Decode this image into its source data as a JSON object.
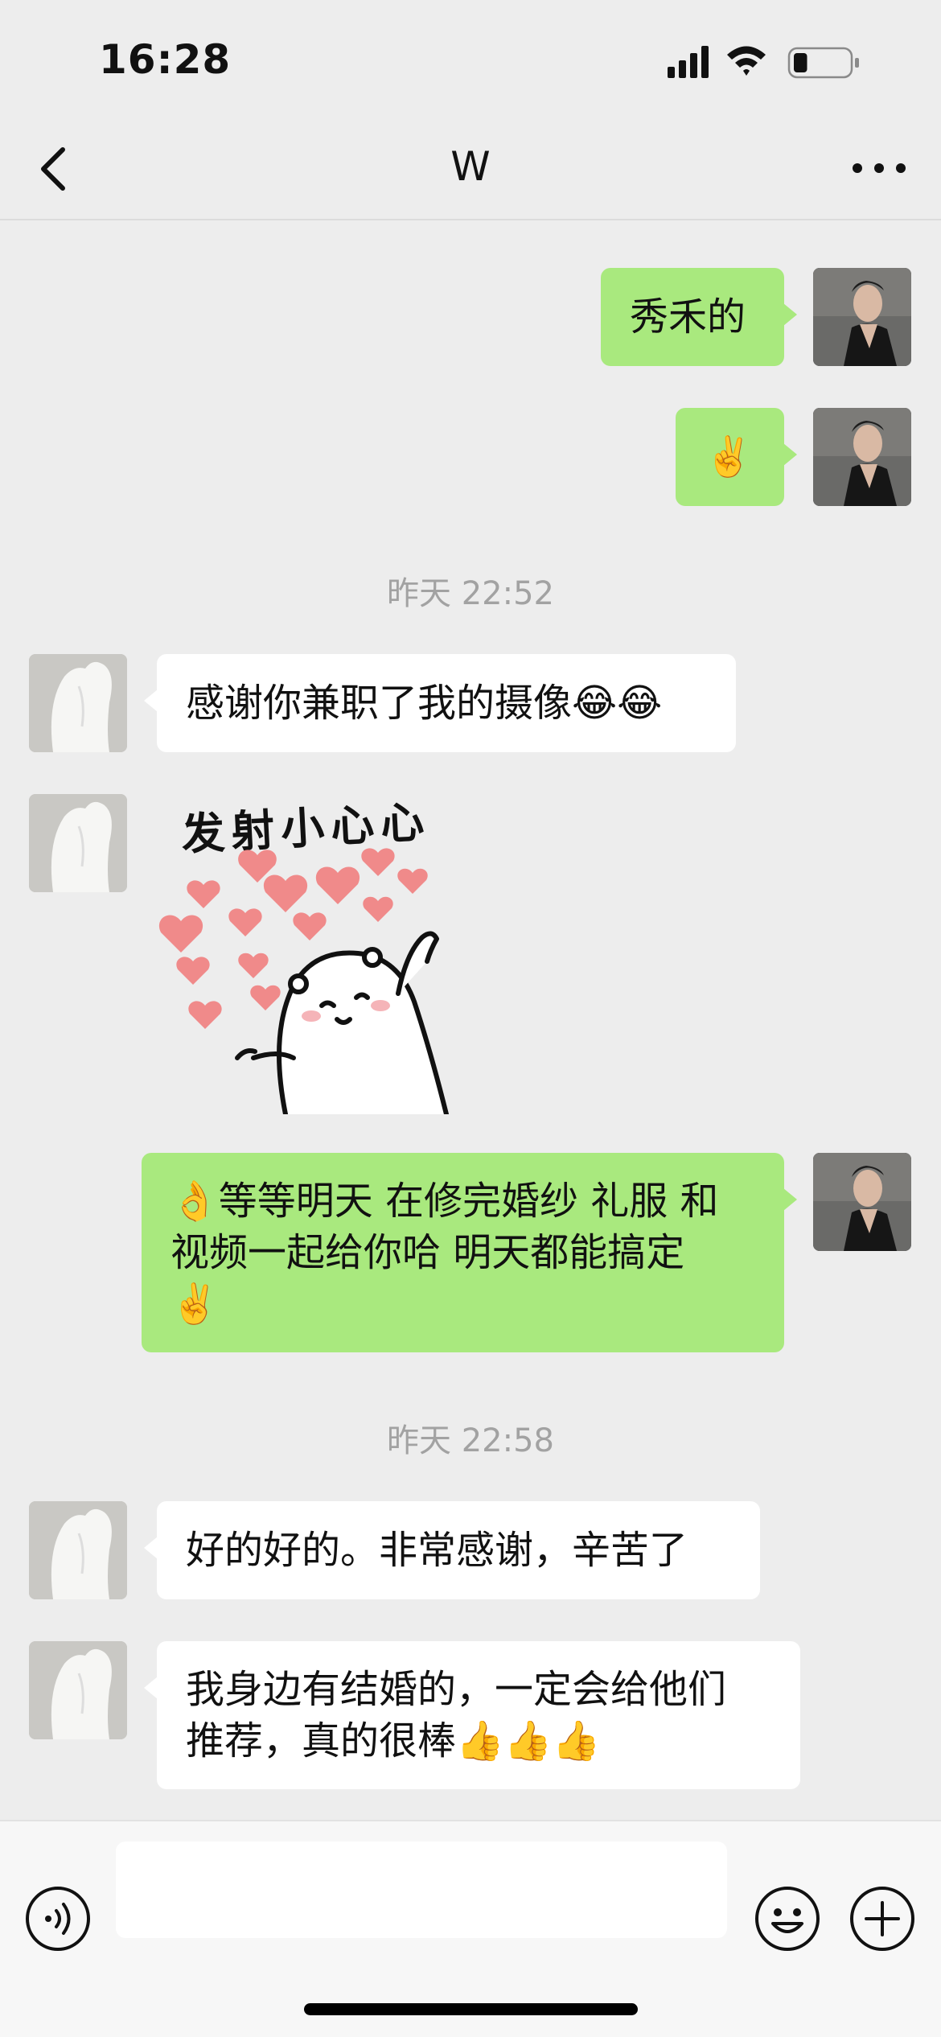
{
  "status_bar": {
    "time": "16:28",
    "icons": [
      "cellular-signal-icon",
      "wifi-icon",
      "battery-icon"
    ],
    "battery_level": 0.25
  },
  "nav": {
    "title": "W",
    "back_icon": "chevron-left-icon",
    "more_icon": "more-dots-icon"
  },
  "messages": [
    {
      "from": "me",
      "text": "秀禾的"
    },
    {
      "from": "me",
      "text": "✌️"
    },
    {
      "timestamp": "昨天 22:52"
    },
    {
      "from": "them",
      "text": "感谢你兼职了我的摄像😂😂"
    },
    {
      "from": "them",
      "sticker": "heart-shooting-bear-sticker",
      "sticker_text": "发射小心心"
    },
    {
      "from": "me",
      "text": "👌等等明天 在修完婚纱 礼服 和\n视频一起给你哈 明天都能搞定\n✌️"
    },
    {
      "timestamp": "昨天 22:58"
    },
    {
      "from": "them",
      "text": "好的好的。非常感谢，辛苦了"
    },
    {
      "from": "them",
      "text": "我身边有结婚的，一定会给他们\n推荐，真的很棒👍👍👍"
    }
  ],
  "input_bar": {
    "voice_icon": "voice-icon",
    "emoji_icon": "emoji-icon",
    "plus_icon": "plus-icon",
    "input_value": ""
  },
  "colors": {
    "background": "#ededed",
    "my_bubble": "#a9e97e",
    "their_bubble": "#ffffff",
    "timestamp": "#a2a2a2",
    "heart": "#f08a8a"
  }
}
